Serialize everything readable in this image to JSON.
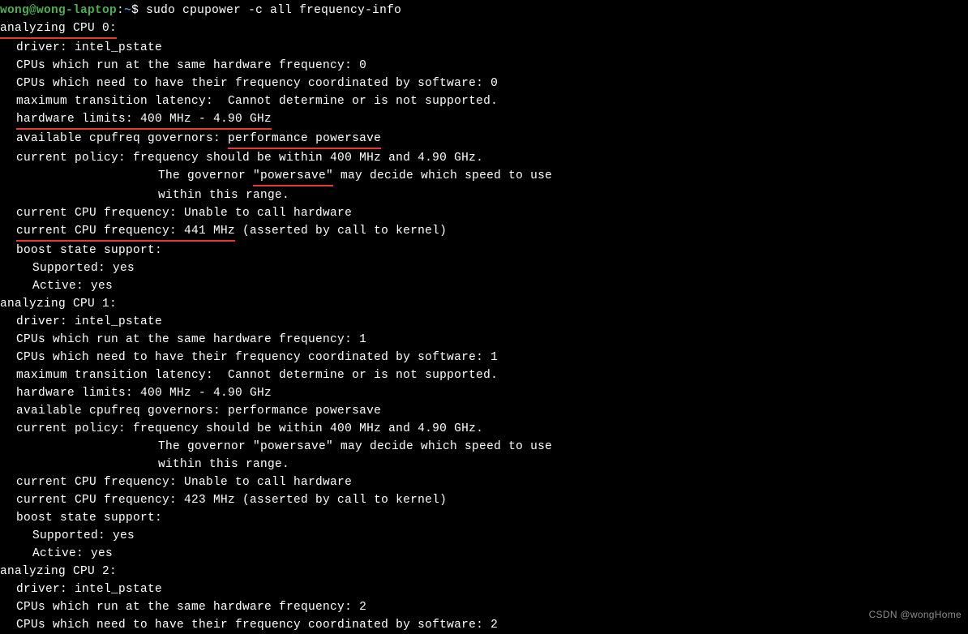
{
  "prompt": {
    "user": "wong",
    "at": "@",
    "host": "wong-laptop",
    "colon": ":",
    "cwd": "~",
    "dollar": "$ "
  },
  "command": "sudo cpupower -c all frequency-info",
  "cpu0": {
    "header": "analyzing CPU 0:",
    "driver": "driver: intel_pstate",
    "same_hw": "CPUs which run at the same hardware frequency: 0",
    "coord_sw": "CPUs which need to have their frequency coordinated by software: 0",
    "latency": "maximum transition latency:  Cannot determine or is not supported.",
    "hw_limits": "hardware limits: 400 MHz - 4.90 GHz",
    "governors_pre": "available cpufreq governors: ",
    "governors": "performance powersave",
    "policy1": "current policy: frequency should be within 400 MHz and 4.90 GHz.",
    "policy2a": "The governor ",
    "policy2b": "\"powersave\"",
    "policy2c": " may decide which speed to use",
    "policy3": "within this range.",
    "freq_hw": "current CPU frequency: Unable to call hardware",
    "freq_kernel_a": "current CPU frequency: 441 MHz",
    "freq_kernel_b": " (asserted by call to kernel)",
    "boost": "boost state support:",
    "supported": "Supported: yes",
    "active": "Active: yes"
  },
  "cpu1": {
    "header": "analyzing CPU 1:",
    "driver": "driver: intel_pstate",
    "same_hw": "CPUs which run at the same hardware frequency: 1",
    "coord_sw": "CPUs which need to have their frequency coordinated by software: 1",
    "latency": "maximum transition latency:  Cannot determine or is not supported.",
    "hw_limits": "hardware limits: 400 MHz - 4.90 GHz",
    "governors": "available cpufreq governors: performance powersave",
    "policy1": "current policy: frequency should be within 400 MHz and 4.90 GHz.",
    "policy2": "The governor \"powersave\" may decide which speed to use",
    "policy3": "within this range.",
    "freq_hw": "current CPU frequency: Unable to call hardware",
    "freq_kernel": "current CPU frequency: 423 MHz (asserted by call to kernel)",
    "boost": "boost state support:",
    "supported": "Supported: yes",
    "active": "Active: yes"
  },
  "cpu2": {
    "header": "analyzing CPU 2:",
    "driver": "driver: intel_pstate",
    "same_hw": "CPUs which run at the same hardware frequency: 2",
    "coord_sw": "CPUs which need to have their frequency coordinated by software: 2"
  },
  "watermark": "CSDN @wongHome"
}
